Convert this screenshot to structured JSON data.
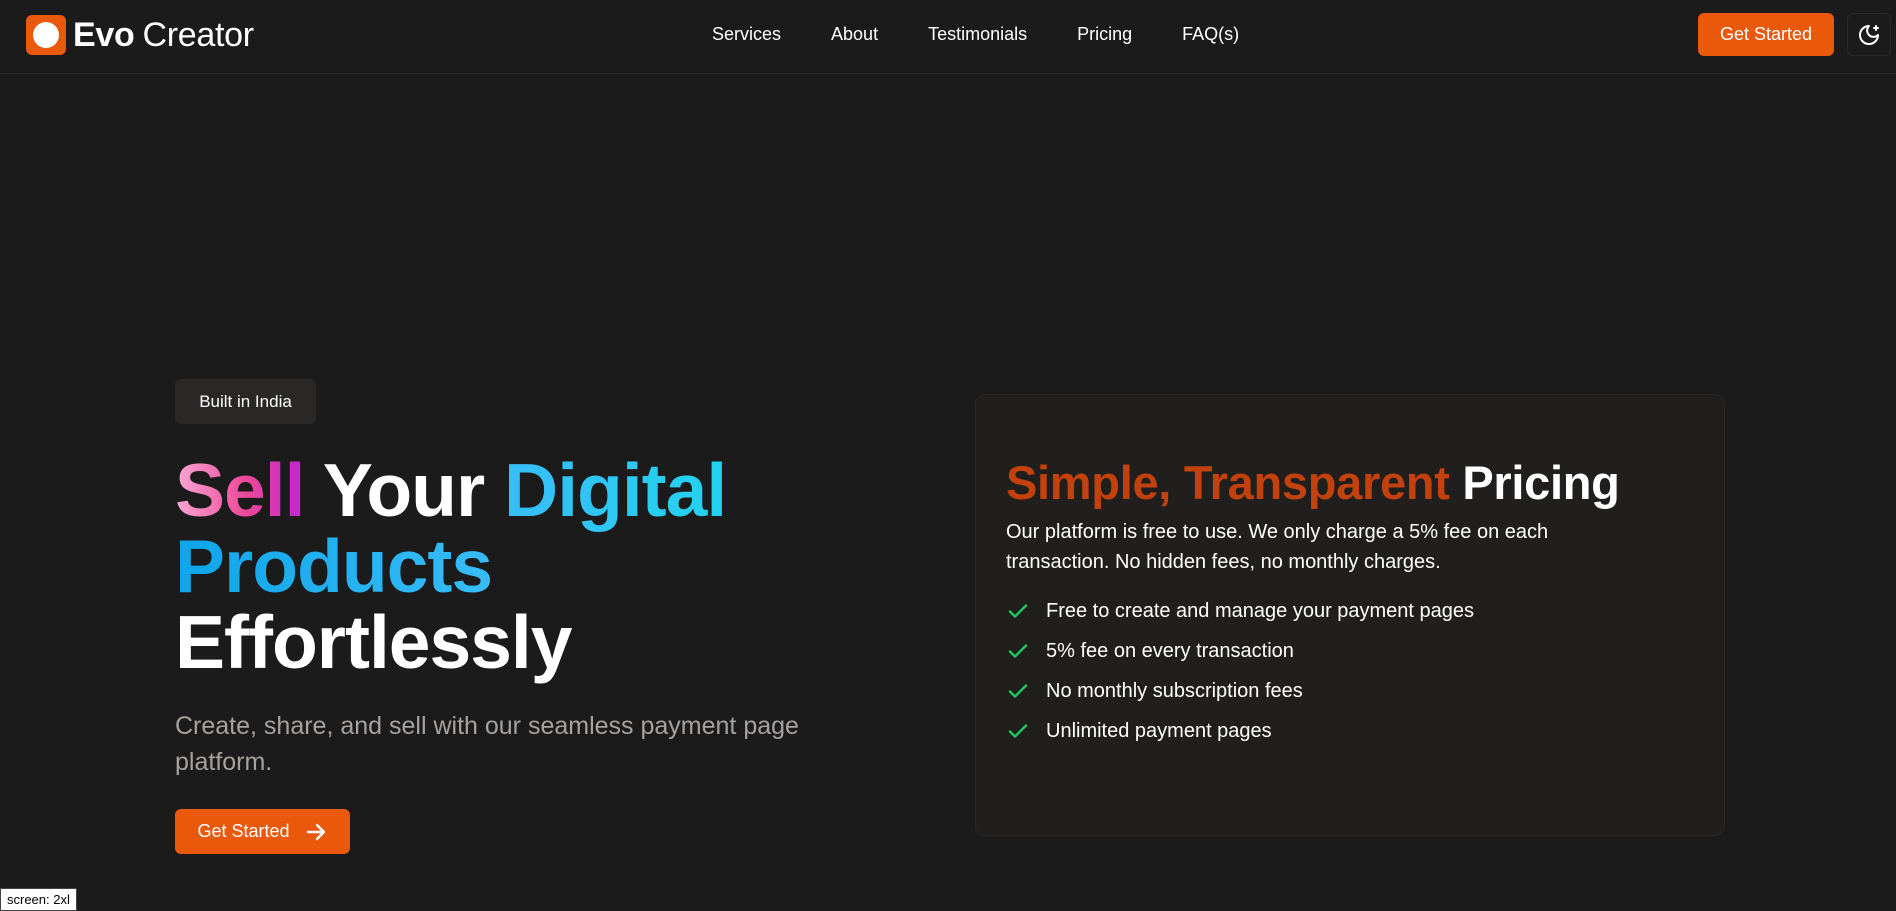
{
  "brand": {
    "name_bold": "Evo",
    "name_regular": "Creator"
  },
  "nav": {
    "links": [
      "Services",
      "About",
      "Testimonials",
      "Pricing",
      "FAQ(s)"
    ],
    "cta_label": "Get Started",
    "theme_icon": "moon-stars-icon"
  },
  "hero": {
    "badge": "Built in India",
    "title_words": [
      "Sell",
      "Your",
      "Digital",
      "Products",
      "Effortlessly"
    ],
    "subtitle": "Create, share, and sell with our seamless payment page platform.",
    "cta_label": "Get Started",
    "cta_icon": "arrow-right-icon"
  },
  "pricing": {
    "title_accent": "Simple, Transparent",
    "title_rest": "Pricing",
    "description": "Our platform is free to use. We only charge a 5% fee on each transaction. No hidden fees, no monthly charges.",
    "features": [
      "Free to create and manage your payment pages",
      "5% fee on every transaction",
      "No monthly subscription fees",
      "Unlimited payment pages"
    ],
    "check_icon": "check-icon"
  },
  "debug": {
    "screen_label": "screen: 2xl"
  },
  "colors": {
    "background": "#1b1b1b",
    "accent": "#ea580c",
    "accent_dark": "#c2410c",
    "card": "#201f1d",
    "check": "#22c55e",
    "muted_text": "#a8a29e"
  }
}
